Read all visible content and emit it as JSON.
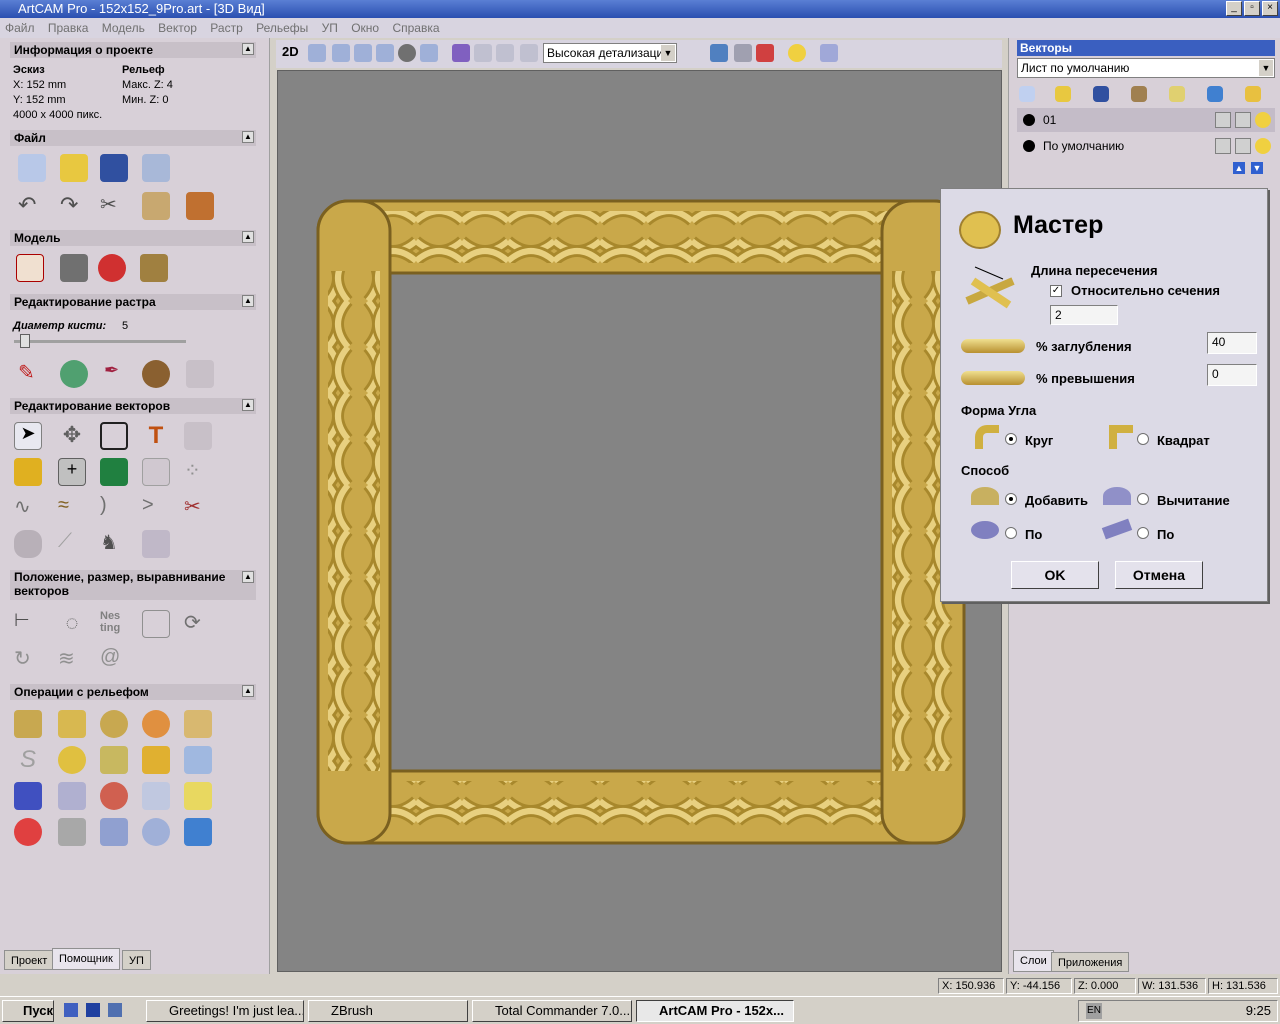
{
  "window": {
    "title": "ArtCAM Pro - 152x152_9Pro.art - [3D Вид]"
  },
  "menu": [
    "Файл",
    "Правка",
    "Модель",
    "Вектор",
    "Растр",
    "Рельефы",
    "УП",
    "Окно",
    "Справка"
  ],
  "project": {
    "header": "Информация о проекте",
    "sketch_label": "Эскиз",
    "relief_label": "Рельеф",
    "x": "X: 152 mm",
    "y": "Y: 152 mm",
    "pixels": "4000 x 4000 пикс.",
    "max_z": "Макс. Z: 4",
    "min_z": "Мин. Z: 0"
  },
  "sections": {
    "file": "Файл",
    "model": "Модель",
    "raster": "Редактирование растра",
    "vectors": "Редактирование векторов",
    "position": "Положение, размер, выравнивание векторов",
    "relief_ops": "Операции с рельефом"
  },
  "brush": {
    "label": "Диаметр кисти:",
    "value": "5"
  },
  "toolbar": {
    "view_2d": "2D",
    "detail": "Высокая детализация"
  },
  "left_tabs": [
    "Проект",
    "Помощник",
    "УП"
  ],
  "vectors_panel": {
    "title": "Векторы",
    "sheet": "Лист по умолчанию",
    "layers": [
      "01",
      "По умолчанию"
    ]
  },
  "right_tabs": [
    "Слои",
    "Приложения"
  ],
  "wizard": {
    "title": "Мастер",
    "crossing_length": "Длина пересечения",
    "relative_label": "Относительно сечения",
    "relative_value": "2",
    "depth_label": "% заглубления",
    "depth_value": "40",
    "excess_label": "% превышения",
    "excess_value": "0",
    "corner_shape": "Форма Угла",
    "corner_circle": "Круг",
    "corner_square": "Квадрат",
    "method": "Способ",
    "add": "Добавить",
    "subtract": "Вычитание",
    "by1": "По",
    "by2": "По",
    "ok": "OK",
    "cancel": "Отмена"
  },
  "status": {
    "x": "X: 150.936",
    "y": "Y: -44.156",
    "z": "Z: 0.000",
    "w": "W: 131.536",
    "h": "H: 131.536"
  },
  "taskbar": {
    "start": "Пуск",
    "tasks": [
      "Greetings! I'm just lea...",
      "ZBrush",
      "Total Commander 7.0...",
      "ArtCAM Pro - 152x..."
    ],
    "lang": "EN",
    "time": "9:25"
  },
  "colors": {
    "frame_gold": "#c9a84a",
    "viewport": "#848484",
    "title_blue": "#2a4fb0"
  }
}
